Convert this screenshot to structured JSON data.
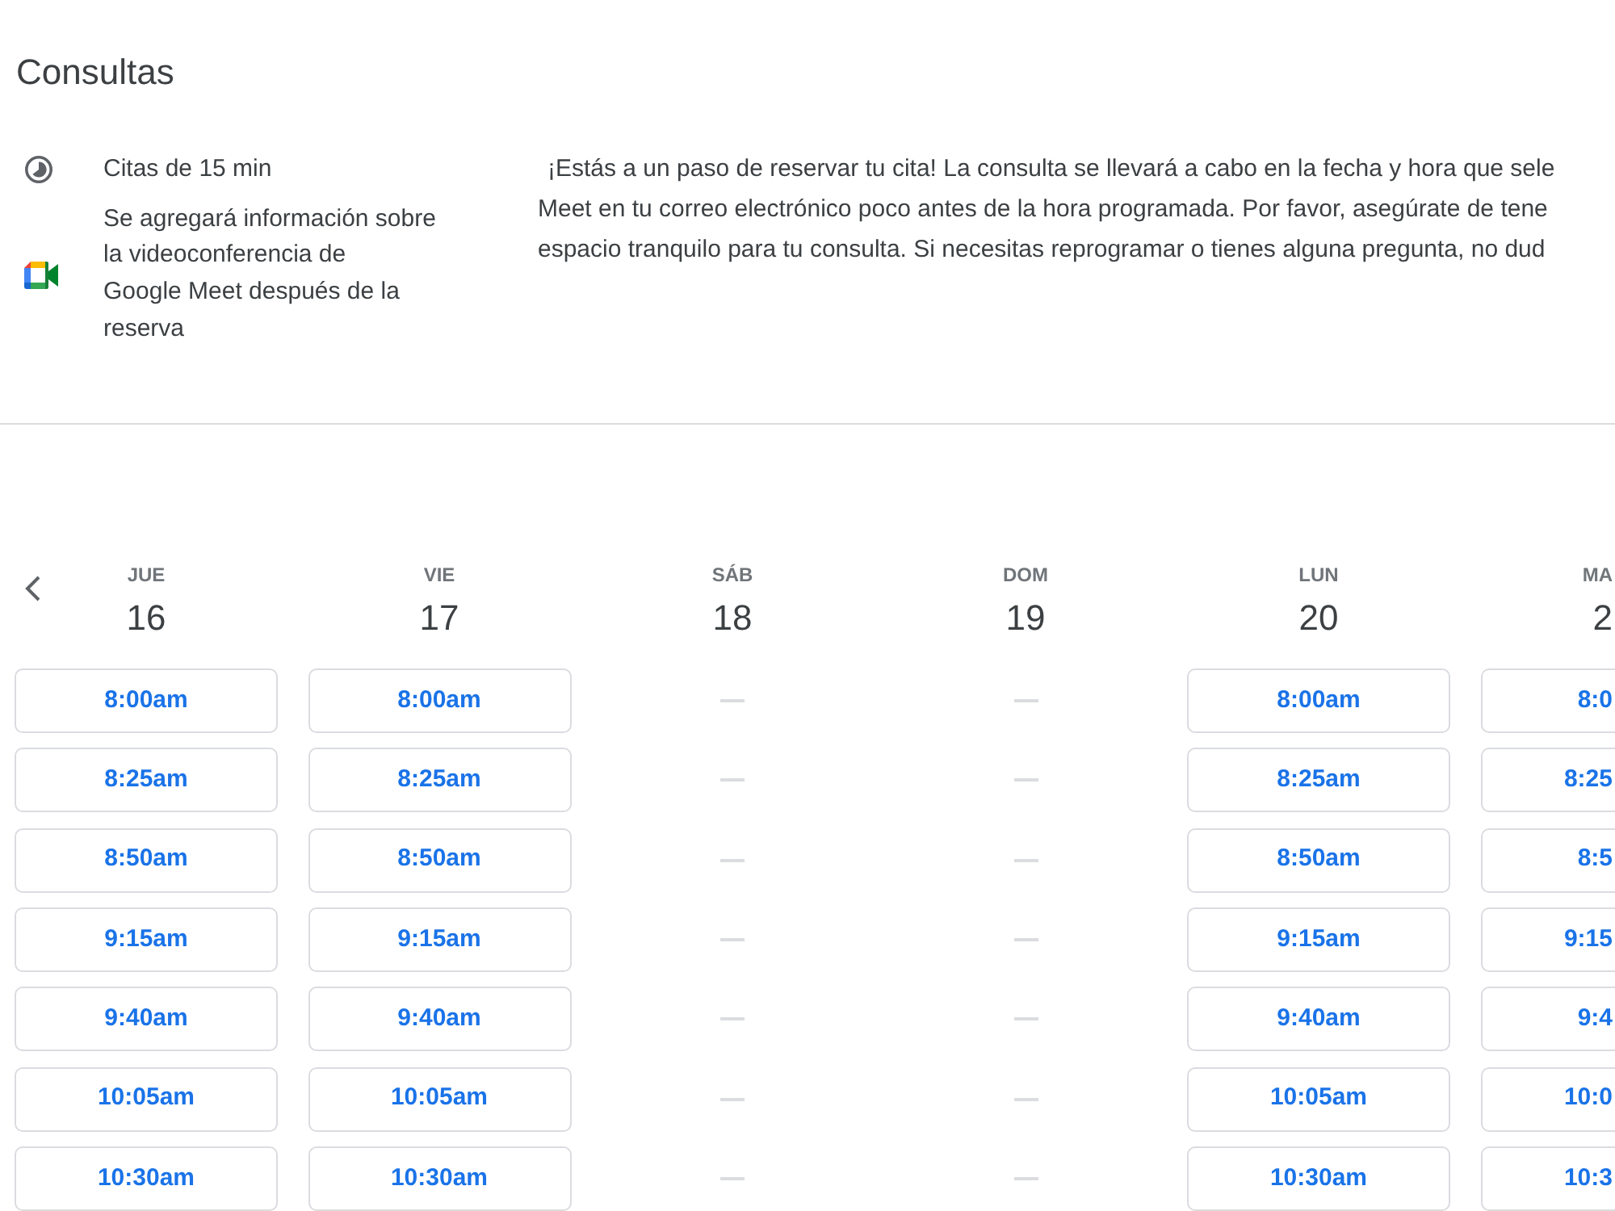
{
  "page": {
    "title": "Consultas"
  },
  "details": [
    {
      "kind": "duration",
      "lines": [
        "Citas de 15 min"
      ]
    },
    {
      "kind": "video_call",
      "lines": [
        "Se agregará información sobre",
        "la videoconferencia de",
        "Google Meet después de la",
        "reserva"
      ]
    }
  ],
  "description": {
    "lines": [
      "¡Estás a un paso de reservar tu cita! La consulta se llevará a cabo en la fecha y hora que sele",
      "Meet en tu correo electrónico poco antes de la hora programada. Por favor, asegúrate de tene",
      "espacio tranquilo para tu consulta. Si necesitas reprogramar o tienes alguna pregunta, no dud"
    ]
  },
  "calendar": {
    "days": [
      {
        "weekday": "JUE",
        "date": "16",
        "slots": [
          "8:00am",
          "8:25am",
          "8:50am",
          "9:15am",
          "9:40am",
          "10:05am",
          "10:30am"
        ]
      },
      {
        "weekday": "VIE",
        "date": "17",
        "slots": [
          "8:00am",
          "8:25am",
          "8:50am",
          "9:15am",
          "9:40am",
          "10:05am",
          "10:30am"
        ]
      },
      {
        "weekday": "SÁB",
        "date": "18"
      },
      {
        "weekday": "DOM",
        "date": "19"
      },
      {
        "weekday": "LUN",
        "date": "20",
        "slots": [
          "8:00am",
          "8:25am",
          "8:50am",
          "9:15am",
          "9:40am",
          "10:05am",
          "10:30am"
        ]
      },
      {
        "weekday": "MA",
        "date": "2",
        "slots": [
          "8:0",
          "8:25",
          "8:5",
          "9:15",
          "9:4",
          "10:0",
          "10:3"
        ]
      }
    ]
  }
}
